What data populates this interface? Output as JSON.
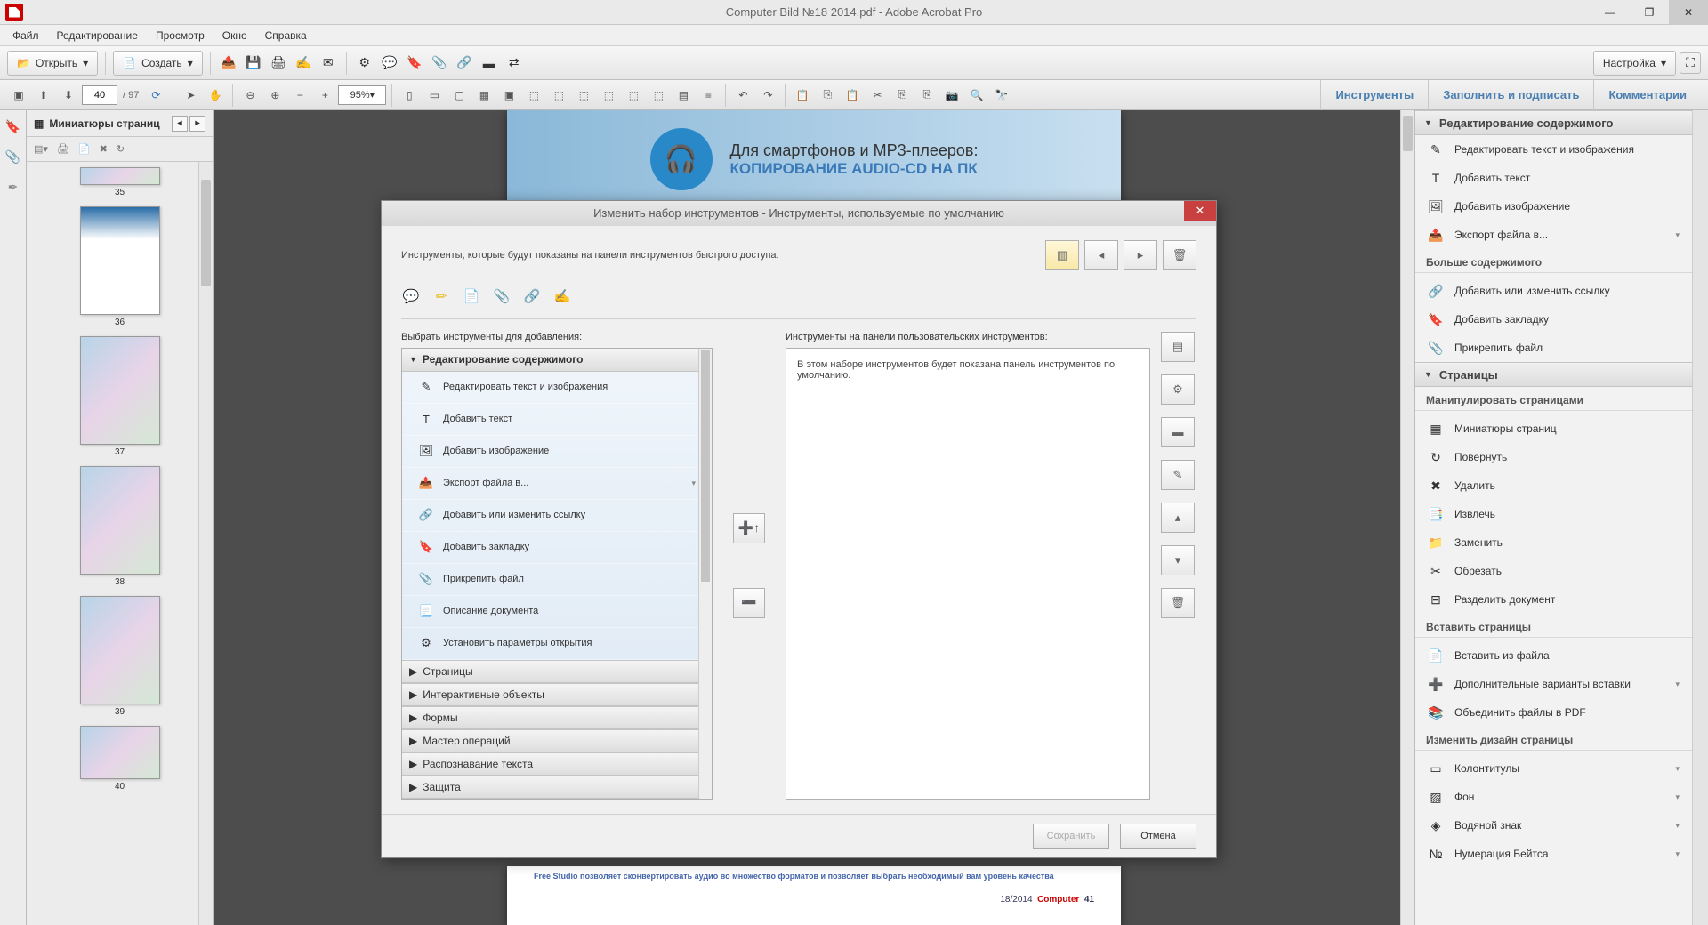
{
  "title": "Computer Bild №18 2014.pdf - Adobe Acrobat Pro",
  "menu": [
    "Файл",
    "Редактирование",
    "Просмотр",
    "Окно",
    "Справка"
  ],
  "toolbar": {
    "open": "Открыть",
    "create": "Создать",
    "settings": "Настройка"
  },
  "nav": {
    "page": "40",
    "pages": "/ 97",
    "zoom": "95%"
  },
  "panelTabs": [
    "Инструменты",
    "Заполнить и подписать",
    "Комментарии"
  ],
  "thumbs": {
    "title": "Миниатюры страниц",
    "labels": [
      "35",
      "36",
      "37",
      "38",
      "39",
      "40"
    ]
  },
  "pagetop": {
    "l1": "Для смартфонов и MP3-плееров:",
    "l2": "КОПИРОВАНИЕ AUDIO-CD НА ПК"
  },
  "pagebot": {
    "txt": "Free Studio позволяет сконвертировать аудио во множество форматов и позволяет выбрать необходимый вам уровень качества",
    "num": "18/2014",
    "mag": "Computer",
    "pg": "41"
  },
  "dialog": {
    "title": "Изменить набор инструментов - Инструменты, используемые по умолчанию",
    "hdr": "Инструменты, которые будут показаны на панели инструментов быстрого доступа:",
    "leftLabel": "Выбрать инструменты для добавления:",
    "rightLabel": "Инструменты на панели пользовательских инструментов:",
    "rightMsg": "В этом наборе инструментов будет показана панель инструментов по умолчанию.",
    "cat0": "Редактирование содержимого",
    "items": [
      {
        "ico": "✎",
        "t": "Редактировать текст и изображения"
      },
      {
        "ico": "T",
        "t": "Добавить текст"
      },
      {
        "ico": "🖼",
        "t": "Добавить изображение"
      },
      {
        "ico": "📤",
        "t": "Экспорт файла в...",
        "chev": true
      },
      {
        "ico": "🔗",
        "t": "Добавить или изменить ссылку"
      },
      {
        "ico": "🔖",
        "t": "Добавить закладку"
      },
      {
        "ico": "📎",
        "t": "Прикрепить файл"
      },
      {
        "ico": "📃",
        "t": "Описание документа"
      },
      {
        "ico": "⚙",
        "t": "Установить параметры открытия"
      }
    ],
    "cats": [
      "Страницы",
      "Интерактивные объекты",
      "Формы",
      "Мастер операций",
      "Распознавание текста",
      "Защита"
    ],
    "save": "Сохранить",
    "cancel": "Отмена"
  },
  "right": {
    "s1": "Редактирование содержимого",
    "s1items": [
      {
        "ico": "✎",
        "t": "Редактировать текст и изображения"
      },
      {
        "ico": "T",
        "t": "Добавить текст"
      },
      {
        "ico": "🖼",
        "t": "Добавить изображение"
      },
      {
        "ico": "📤",
        "t": "Экспорт файла в...",
        "chev": true
      }
    ],
    "sub1": "Больше содержимого",
    "sub1items": [
      {
        "ico": "🔗",
        "t": "Добавить или изменить ссылку"
      },
      {
        "ico": "🔖",
        "t": "Добавить закладку"
      },
      {
        "ico": "📎",
        "t": "Прикрепить файл"
      }
    ],
    "s2": "Страницы",
    "sub2": "Манипулировать страницами",
    "sub2items": [
      {
        "ico": "▦",
        "t": "Миниатюры страниц"
      },
      {
        "ico": "↻",
        "t": "Повернуть"
      },
      {
        "ico": "✖",
        "t": "Удалить"
      },
      {
        "ico": "📑",
        "t": "Извлечь"
      },
      {
        "ico": "📁",
        "t": "Заменить"
      },
      {
        "ico": "✂",
        "t": "Обрезать"
      },
      {
        "ico": "⊟",
        "t": "Разделить документ"
      }
    ],
    "sub3": "Вставить страницы",
    "sub3items": [
      {
        "ico": "📄",
        "t": "Вставить из файла"
      },
      {
        "ico": "➕",
        "t": "Дополнительные варианты вставки",
        "chev": true
      },
      {
        "ico": "📚",
        "t": "Объединить файлы в PDF"
      }
    ],
    "sub4": "Изменить дизайн страницы",
    "sub4items": [
      {
        "ico": "▭",
        "t": "Колонтитулы",
        "chev": true
      },
      {
        "ico": "▨",
        "t": "Фон",
        "chev": true
      },
      {
        "ico": "◈",
        "t": "Водяной знак",
        "chev": true
      },
      {
        "ico": "№",
        "t": "Нумерация Бейтса",
        "chev": true
      }
    ]
  }
}
